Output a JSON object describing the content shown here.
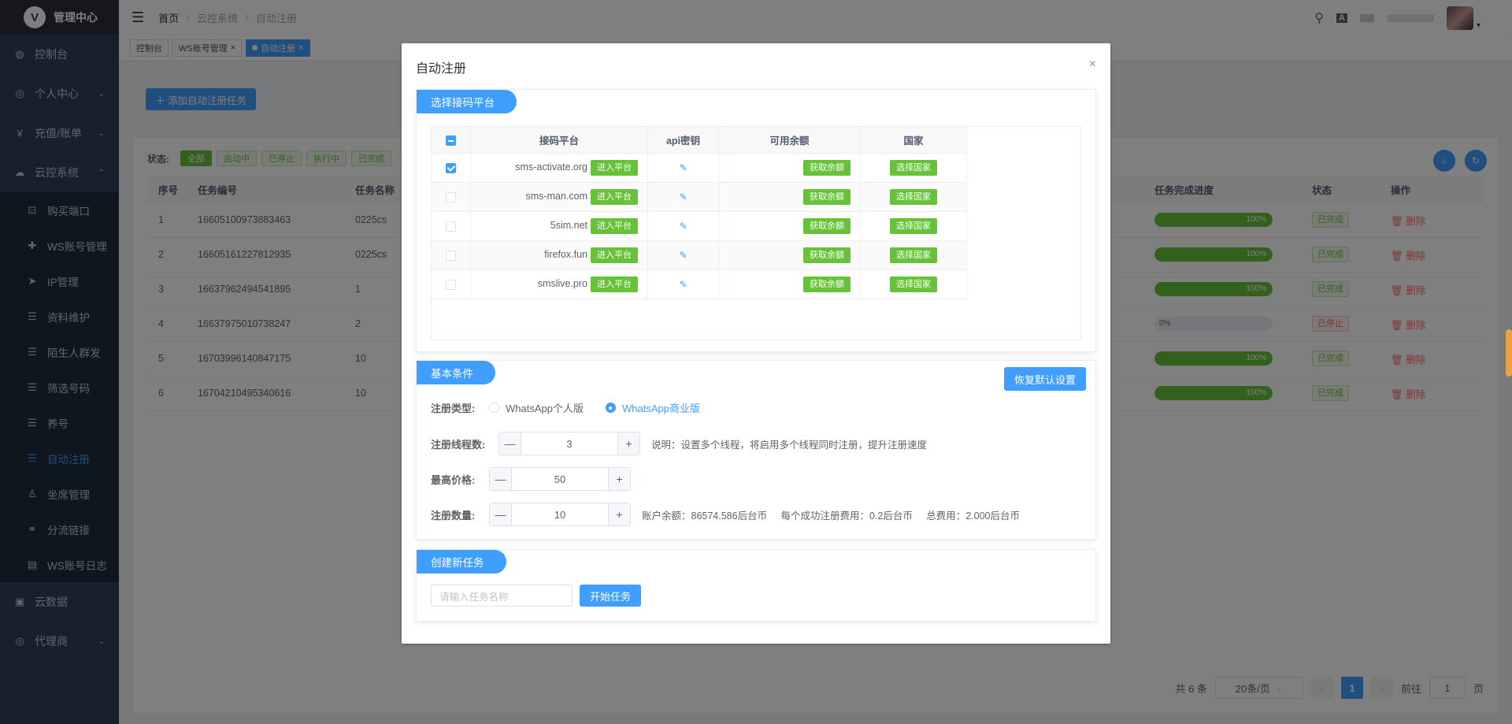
{
  "app": {
    "logo_glyph": "V",
    "title": "管理中心"
  },
  "sidebar": {
    "items": [
      {
        "icon": "dashboard-icon",
        "glyph": "◍",
        "label": "控制台",
        "arrow": ""
      },
      {
        "icon": "user-icon",
        "glyph": "◎",
        "label": "个人中心",
        "arrow": "⌄"
      },
      {
        "icon": "yen-icon",
        "glyph": "¥",
        "label": "充值/账单",
        "arrow": "⌄"
      },
      {
        "icon": "cloud-icon",
        "glyph": "☁",
        "label": "云控系统",
        "arrow": "⌃"
      }
    ],
    "sub_items": [
      {
        "icon": "cart-icon",
        "glyph": "⊡",
        "label": "购买端口"
      },
      {
        "icon": "plus-icon",
        "glyph": "✚",
        "label": "WS账号管理"
      },
      {
        "icon": "send-icon",
        "glyph": "➤",
        "label": "IP管理"
      },
      {
        "icon": "list-icon",
        "glyph": "☰",
        "label": "资料维护"
      },
      {
        "icon": "list-icon",
        "glyph": "☰",
        "label": "陌生人群发"
      },
      {
        "icon": "list-icon",
        "glyph": "☰",
        "label": "筛选号码"
      },
      {
        "icon": "list-icon",
        "glyph": "☰",
        "label": "养号"
      },
      {
        "icon": "list-icon",
        "glyph": "☰",
        "label": "自动注册"
      },
      {
        "icon": "person-icon",
        "glyph": "♙",
        "label": "坐席管理"
      },
      {
        "icon": "link-icon",
        "glyph": "⚭",
        "label": "分流链接"
      },
      {
        "icon": "log-icon",
        "glyph": "▤",
        "label": "WS账号日志"
      }
    ],
    "bottom_items": [
      {
        "icon": "data-icon",
        "glyph": "▣",
        "label": "云数据",
        "arrow": ""
      },
      {
        "icon": "agent-icon",
        "glyph": "◎",
        "label": "代理商",
        "arrow": "⌄"
      }
    ]
  },
  "navbar": {
    "hamburger": "☰",
    "breadcrumb": [
      "首页",
      "云控系统",
      "自动注册"
    ],
    "sep": "/",
    "icons": {
      "search": "⚲",
      "translate": "A",
      "dropdown": "▾"
    }
  },
  "tags": [
    {
      "label": "控制台",
      "closable": false,
      "active": false
    },
    {
      "label": "WS账号管理",
      "closable": true,
      "active": false
    },
    {
      "label": "自动注册",
      "closable": true,
      "active": true
    }
  ],
  "tag_close": "×",
  "page": {
    "add_button": "＋ 添加自动注册任务",
    "status_label": "状态:",
    "status_chips": [
      "全部",
      "启动中",
      "已停止",
      "执行中",
      "已完成"
    ],
    "circle_btns": [
      "⌕",
      "↻"
    ],
    "columns": [
      "序号",
      "任务编号",
      "任务名称",
      "",
      "任务完成进度",
      "状态",
      "操作"
    ],
    "rows": [
      {
        "no": "1",
        "id": "16605100973883463",
        "name": "0225cs",
        "progress": 1.0,
        "progress_text": "100%",
        "status": "已完成",
        "stopped": false
      },
      {
        "no": "2",
        "id": "16605161227812935",
        "name": "0225cs",
        "progress": 1.0,
        "progress_text": "100%",
        "status": "已完成",
        "stopped": false
      },
      {
        "no": "3",
        "id": "16637962494541895",
        "name": "1",
        "progress": 1.0,
        "progress_text": "100%",
        "status": "已完成",
        "stopped": false
      },
      {
        "no": "4",
        "id": "16637975010738247",
        "name": "2",
        "progress": 0.0,
        "progress_text": "0%",
        "status": "已停止",
        "stopped": true
      },
      {
        "no": "5",
        "id": "16703996140847175",
        "name": "10",
        "progress": 1.0,
        "progress_text": "100%",
        "status": "已完成",
        "stopped": false
      },
      {
        "no": "6",
        "id": "16704210495340616",
        "name": "10",
        "progress": 1.0,
        "progress_text": "100%",
        "status": "已完成",
        "stopped": false
      }
    ],
    "delete_label": "🗑 删除",
    "pager": {
      "total": "共 6 条",
      "size": "20条/页",
      "prev": "‹",
      "current": "1",
      "next": "›",
      "goto": "前往",
      "goto_value": "1",
      "page_suffix": "页"
    }
  },
  "dialog": {
    "title": "自动注册",
    "close": "×",
    "platform_section": {
      "header": "选择接码平台",
      "columns": [
        "",
        "接码平台",
        "api密钥",
        "可用余额",
        "国家"
      ],
      "rows": [
        {
          "checked": true,
          "name": "sms-activate.org"
        },
        {
          "checked": false,
          "name": "sms-man.com"
        },
        {
          "checked": false,
          "name": "5sim.net"
        },
        {
          "checked": false,
          "name": "firefox.fun"
        },
        {
          "checked": false,
          "name": "smslive.pro"
        }
      ],
      "enter_label": "进入平台",
      "edit_glyph": "✎",
      "balance_label": "获取余额",
      "country_label": "选择国家"
    },
    "basic_section": {
      "header": "基本条件",
      "reset_button": "恢复默认设置",
      "type_label": "注册类型:",
      "type_options": [
        "WhatsApp个人版",
        "WhatsApp商业版"
      ],
      "type_selected": 1,
      "threads_label": "注册线程数:",
      "threads_value": "3",
      "threads_hint": "说明：设置多个线程，将启用多个线程同时注册，提升注册速度",
      "price_label": "最高价格:",
      "price_value": "50",
      "count_label": "注册数量:",
      "count_value": "10",
      "count_hint": "账户余额：86574.586后台币     每个成功注册费用：0.2后台币     总费用：2.000后台币",
      "minus": "—",
      "plus": "+"
    },
    "create_section": {
      "header": "创建新任务",
      "placeholder": "请输入任务名称",
      "start_button": "开始任务"
    }
  }
}
